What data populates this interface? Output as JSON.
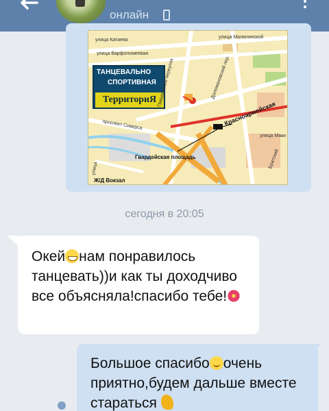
{
  "header": {
    "status": "онлайн",
    "colors": {
      "bar": "#5d81aa",
      "status_text": "#d6e2f0"
    },
    "icons": [
      "back-arrow-icon",
      "phone-icon",
      "more-vert-icon"
    ]
  },
  "map": {
    "logo_line1": "ТАНЦЕВАЛЬНО",
    "logo_line2": "СПОРТИВНАЯ",
    "logo_line3": "ТерриториЯ",
    "streets": [
      "улица Катаева",
      "улица Варфоломеевая",
      "улица Малюгинской",
      "Гвардейский переулок",
      "Доломановский пер.",
      "Красноармейская",
      "проспект Сиверса",
      "Братский",
      "улица Маки",
      "улица"
    ],
    "square": "Гвардейская площадь",
    "station": "Ж/Д Вокзал"
  },
  "timestamp": "сегодня в 20:05",
  "messages": [
    {
      "direction": "in",
      "parts": [
        "Окей",
        "нам понравилось танцевать))и как ты доходчиво все объясняла!спасибо тебе!"
      ]
    },
    {
      "direction": "out",
      "parts": [
        "Большое спасибо",
        "очень приятно,будем  дальше вместе стараться"
      ]
    }
  ],
  "colors": {
    "background": "#e8ecf1",
    "incoming": "#ffffff",
    "outgoing": "#cfe0f3",
    "timestamp": "#8c98a6"
  }
}
